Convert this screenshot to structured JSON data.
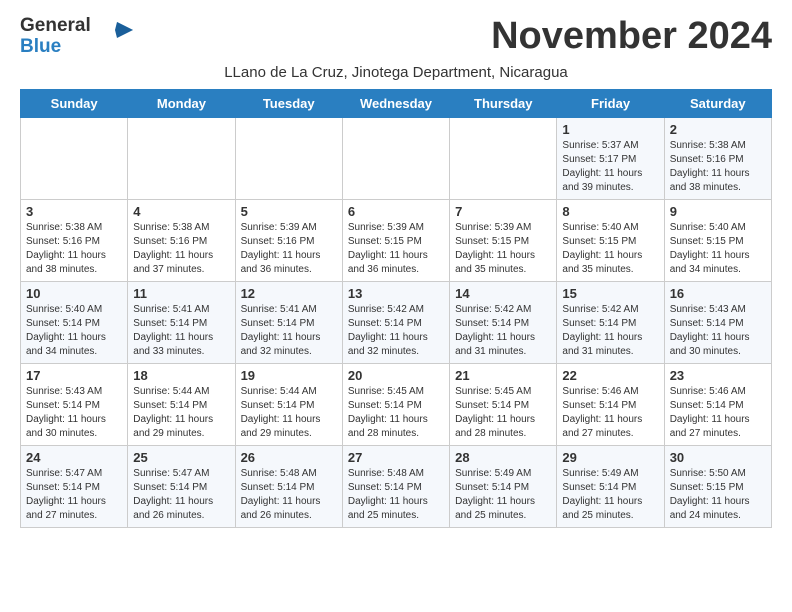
{
  "header": {
    "logo_general": "General",
    "logo_blue": "Blue",
    "month_title": "November 2024",
    "location": "LLano de La Cruz, Jinotega Department, Nicaragua"
  },
  "weekdays": [
    "Sunday",
    "Monday",
    "Tuesday",
    "Wednesday",
    "Thursday",
    "Friday",
    "Saturday"
  ],
  "weeks": [
    [
      {
        "day": "",
        "info": ""
      },
      {
        "day": "",
        "info": ""
      },
      {
        "day": "",
        "info": ""
      },
      {
        "day": "",
        "info": ""
      },
      {
        "day": "",
        "info": ""
      },
      {
        "day": "1",
        "info": "Sunrise: 5:37 AM\nSunset: 5:17 PM\nDaylight: 11 hours and 39 minutes."
      },
      {
        "day": "2",
        "info": "Sunrise: 5:38 AM\nSunset: 5:16 PM\nDaylight: 11 hours and 38 minutes."
      }
    ],
    [
      {
        "day": "3",
        "info": "Sunrise: 5:38 AM\nSunset: 5:16 PM\nDaylight: 11 hours and 38 minutes."
      },
      {
        "day": "4",
        "info": "Sunrise: 5:38 AM\nSunset: 5:16 PM\nDaylight: 11 hours and 37 minutes."
      },
      {
        "day": "5",
        "info": "Sunrise: 5:39 AM\nSunset: 5:16 PM\nDaylight: 11 hours and 36 minutes."
      },
      {
        "day": "6",
        "info": "Sunrise: 5:39 AM\nSunset: 5:15 PM\nDaylight: 11 hours and 36 minutes."
      },
      {
        "day": "7",
        "info": "Sunrise: 5:39 AM\nSunset: 5:15 PM\nDaylight: 11 hours and 35 minutes."
      },
      {
        "day": "8",
        "info": "Sunrise: 5:40 AM\nSunset: 5:15 PM\nDaylight: 11 hours and 35 minutes."
      },
      {
        "day": "9",
        "info": "Sunrise: 5:40 AM\nSunset: 5:15 PM\nDaylight: 11 hours and 34 minutes."
      }
    ],
    [
      {
        "day": "10",
        "info": "Sunrise: 5:40 AM\nSunset: 5:14 PM\nDaylight: 11 hours and 34 minutes."
      },
      {
        "day": "11",
        "info": "Sunrise: 5:41 AM\nSunset: 5:14 PM\nDaylight: 11 hours and 33 minutes."
      },
      {
        "day": "12",
        "info": "Sunrise: 5:41 AM\nSunset: 5:14 PM\nDaylight: 11 hours and 32 minutes."
      },
      {
        "day": "13",
        "info": "Sunrise: 5:42 AM\nSunset: 5:14 PM\nDaylight: 11 hours and 32 minutes."
      },
      {
        "day": "14",
        "info": "Sunrise: 5:42 AM\nSunset: 5:14 PM\nDaylight: 11 hours and 31 minutes."
      },
      {
        "day": "15",
        "info": "Sunrise: 5:42 AM\nSunset: 5:14 PM\nDaylight: 11 hours and 31 minutes."
      },
      {
        "day": "16",
        "info": "Sunrise: 5:43 AM\nSunset: 5:14 PM\nDaylight: 11 hours and 30 minutes."
      }
    ],
    [
      {
        "day": "17",
        "info": "Sunrise: 5:43 AM\nSunset: 5:14 PM\nDaylight: 11 hours and 30 minutes."
      },
      {
        "day": "18",
        "info": "Sunrise: 5:44 AM\nSunset: 5:14 PM\nDaylight: 11 hours and 29 minutes."
      },
      {
        "day": "19",
        "info": "Sunrise: 5:44 AM\nSunset: 5:14 PM\nDaylight: 11 hours and 29 minutes."
      },
      {
        "day": "20",
        "info": "Sunrise: 5:45 AM\nSunset: 5:14 PM\nDaylight: 11 hours and 28 minutes."
      },
      {
        "day": "21",
        "info": "Sunrise: 5:45 AM\nSunset: 5:14 PM\nDaylight: 11 hours and 28 minutes."
      },
      {
        "day": "22",
        "info": "Sunrise: 5:46 AM\nSunset: 5:14 PM\nDaylight: 11 hours and 27 minutes."
      },
      {
        "day": "23",
        "info": "Sunrise: 5:46 AM\nSunset: 5:14 PM\nDaylight: 11 hours and 27 minutes."
      }
    ],
    [
      {
        "day": "24",
        "info": "Sunrise: 5:47 AM\nSunset: 5:14 PM\nDaylight: 11 hours and 27 minutes."
      },
      {
        "day": "25",
        "info": "Sunrise: 5:47 AM\nSunset: 5:14 PM\nDaylight: 11 hours and 26 minutes."
      },
      {
        "day": "26",
        "info": "Sunrise: 5:48 AM\nSunset: 5:14 PM\nDaylight: 11 hours and 26 minutes."
      },
      {
        "day": "27",
        "info": "Sunrise: 5:48 AM\nSunset: 5:14 PM\nDaylight: 11 hours and 25 minutes."
      },
      {
        "day": "28",
        "info": "Sunrise: 5:49 AM\nSunset: 5:14 PM\nDaylight: 11 hours and 25 minutes."
      },
      {
        "day": "29",
        "info": "Sunrise: 5:49 AM\nSunset: 5:14 PM\nDaylight: 11 hours and 25 minutes."
      },
      {
        "day": "30",
        "info": "Sunrise: 5:50 AM\nSunset: 5:15 PM\nDaylight: 11 hours and 24 minutes."
      }
    ]
  ]
}
